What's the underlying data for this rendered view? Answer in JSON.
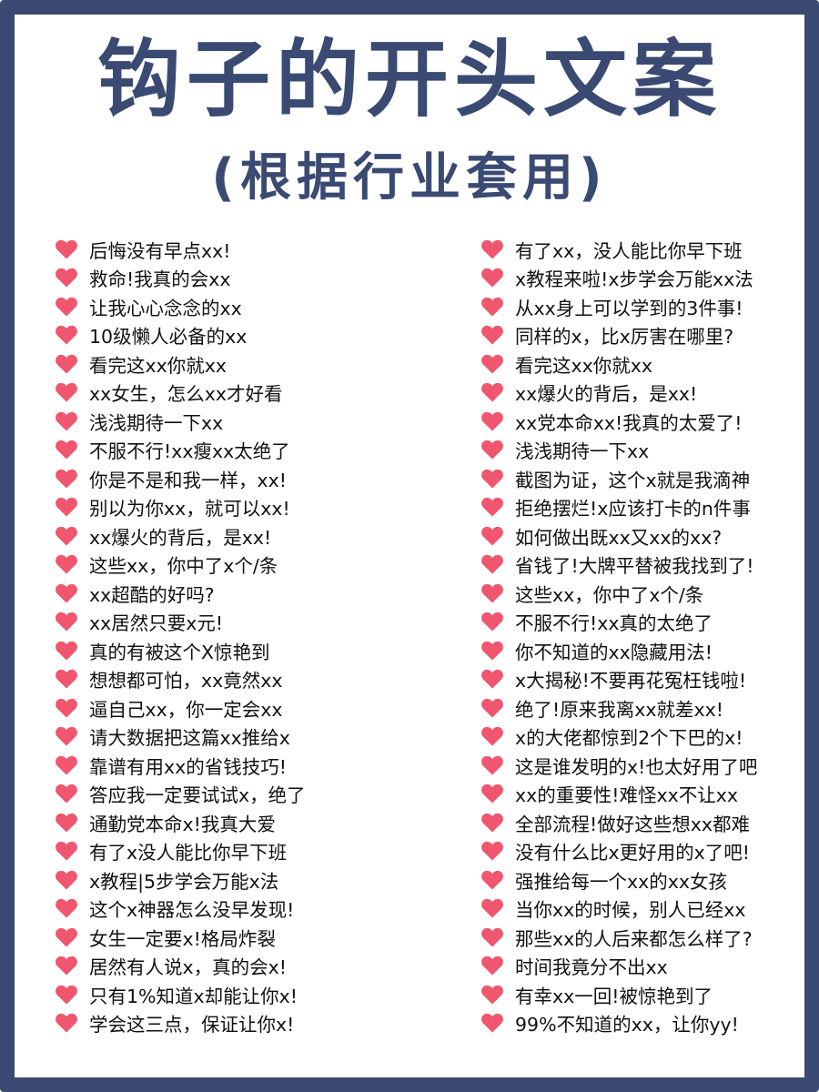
{
  "header": {
    "title": "钩子的开头文案",
    "subtitle": "(根据行业套用)"
  },
  "colors": {
    "primary": "#3a4a72",
    "heart": "#f0566e",
    "text": "#111111",
    "background": "#ffffff"
  },
  "icon": "heart-icon",
  "left_items": [
    "后悔没有早点xx!",
    "救命!我真的会xx",
    "让我心心念念的xx",
    "10级懒人必备的xx",
    "看完这xx你就xx",
    "xx女生，怎么xx才好看",
    "浅浅期待一下xx",
    "不服不行!xx瘦xx太绝了",
    "你是不是和我一样，xx!",
    "别以为你xx，就可以xx!",
    "xx爆火的背后，是xx!",
    "这些xx，你中了x个/条",
    "xx超酷的好吗?",
    "xx居然只要x元!",
    "真的有被这个X惊艳到",
    "想想都可怕，xx竟然xx",
    "逼自己xx，你一定会xx",
    "请大数据把这篇xx推给x",
    "靠谱有用xx的省钱技巧!",
    "答应我一定要试试x，绝了",
    "通勤党本命x!我真大爱",
    "有了x没人能比你早下班",
    "x教程|5步学会万能x法",
    "这个x神器怎么没早发现!",
    "女生一定要x!格局炸裂",
    "居然有人说x，真的会x!",
    "只有1%知道x却能让你x!",
    "学会这三点，保证让你x!"
  ],
  "right_items": [
    "有了xx，没人能比你早下班",
    "x教程来啦!x步学会万能xx法",
    "从xx身上可以学到的3件事!",
    "同样的x，比x厉害在哪里?",
    "看完这xx你就xx",
    "xx爆火的背后，是xx!",
    "xx党本命xx!我真的太爱了!",
    "浅浅期待一下xx",
    "截图为证，这个x就是我滴神",
    "拒绝摆烂!x应该打卡的n件事",
    "如何做出既xx又xx的xx?",
    "省钱了!大牌平替被我找到了!",
    "这些xx，你中了x个/条",
    "不服不行!xx真的太绝了",
    "你不知道的xx隐藏用法!",
    "x大揭秘!不要再花冤枉钱啦!",
    "绝了!原来我离xx就差xx!",
    "x的大佬都惊到2个下巴的x!",
    "这是谁发明的x!也太好用了吧",
    "xx的重要性!难怪xx不让xx",
    "全部流程!做好这些想xx都难",
    "没有什么比x更好用的x了吧!",
    "强推给每一个xx的xx女孩",
    "当你xx的时候，别人已经xx",
    "那些xx的人后来都怎么样了?",
    "时间我竟分不出xx",
    "有幸xx一回!被惊艳到了",
    "99%不知道的xx，让你yy!"
  ]
}
